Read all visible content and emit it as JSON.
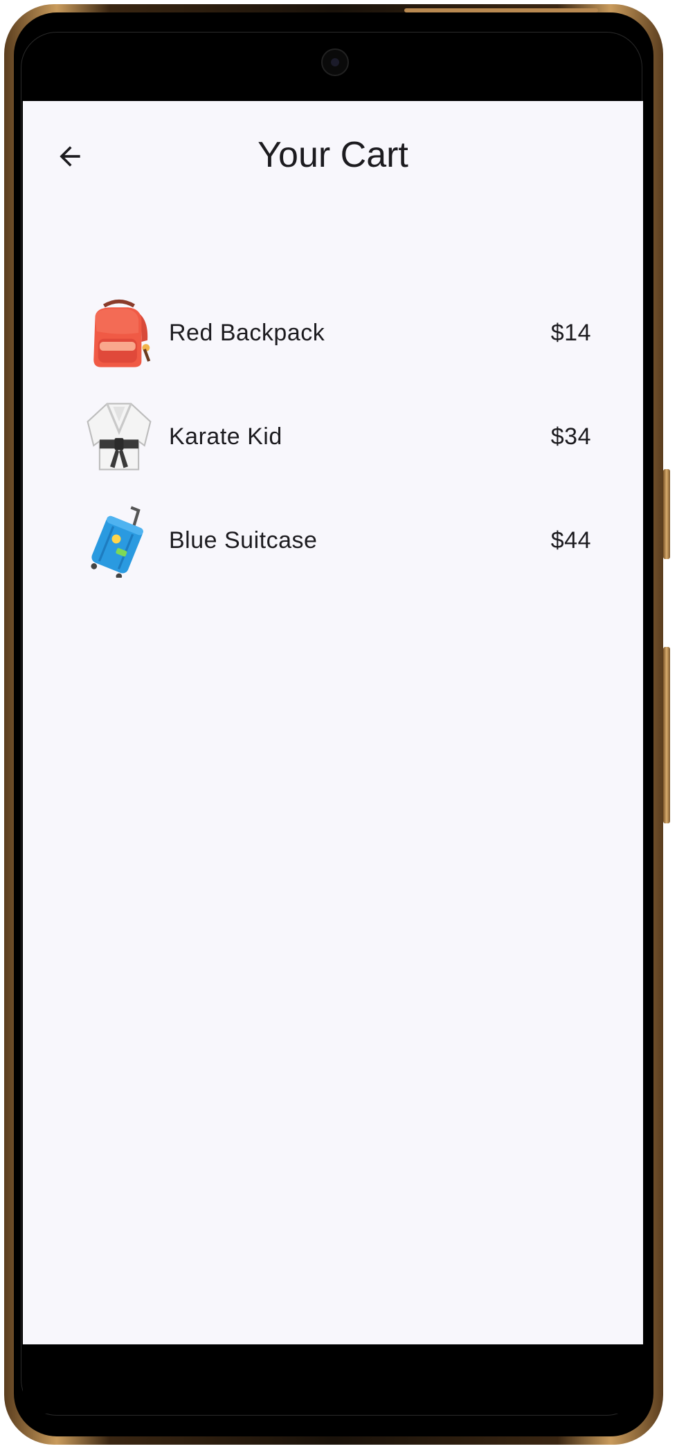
{
  "app_bar": {
    "title": "Your Cart",
    "back_icon": "arrow-back-icon"
  },
  "cart": {
    "items": [
      {
        "name": "Red Backpack",
        "price": "$14",
        "icon": "backpack-icon"
      },
      {
        "name": "Karate Kid",
        "price": "$34",
        "icon": "martial-arts-uniform-icon"
      },
      {
        "name": "Blue Suitcase",
        "price": "$44",
        "icon": "luggage-icon"
      }
    ]
  },
  "colors": {
    "screen_background": "#f8f7fc",
    "text": "#1c1b1f",
    "frame_gold": "#c99b5c"
  }
}
